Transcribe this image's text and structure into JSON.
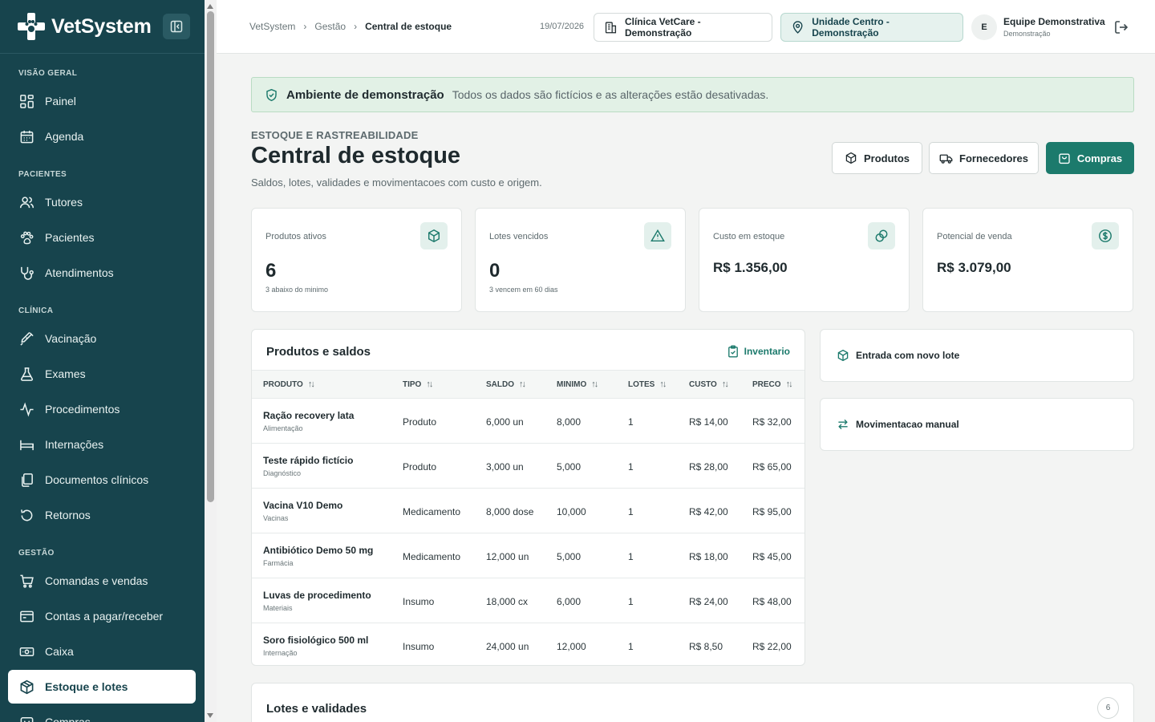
{
  "app": {
    "brand": "VetSystem"
  },
  "sidebar": {
    "sections": {
      "overview": "VISÃO GERAL",
      "patients": "PACIENTES",
      "clinic": "CLÍNICA",
      "management": "GESTÃO"
    },
    "items": [
      {
        "label": "Painel",
        "icon": "grid-icon"
      },
      {
        "label": "Agenda",
        "icon": "calendar-icon"
      },
      {
        "label": "Tutores",
        "icon": "users-icon"
      },
      {
        "label": "Pacientes",
        "icon": "paw-icon"
      },
      {
        "label": "Atendimentos",
        "icon": "stethoscope-icon"
      },
      {
        "label": "Vacinação",
        "icon": "syringe-icon"
      },
      {
        "label": "Exames",
        "icon": "flask-icon"
      },
      {
        "label": "Procedimentos",
        "icon": "activity-icon"
      },
      {
        "label": "Internações",
        "icon": "bed-icon"
      },
      {
        "label": "Documentos clínicos",
        "icon": "documents-icon"
      },
      {
        "label": "Retornos",
        "icon": "rotate-icon"
      },
      {
        "label": "Comandas e vendas",
        "icon": "cart-icon"
      },
      {
        "label": "Contas a pagar/receber",
        "icon": "wallet-icon"
      },
      {
        "label": "Caixa",
        "icon": "cash-icon"
      },
      {
        "label": "Estoque e lotes",
        "icon": "box-icon",
        "active": true
      },
      {
        "label": "Compras",
        "icon": "bag-icon"
      }
    ]
  },
  "topbar": {
    "breadcrumb": [
      "VetSystem",
      "Gestão",
      "Central de estoque"
    ],
    "date": "19/07/2026",
    "clinic": "Clínica VetCare - Demonstração",
    "unit": "Unidade Centro - Demonstração",
    "user": {
      "initial": "E",
      "name": "Equipe Demonstrativa",
      "role": "Demonstração"
    }
  },
  "banner": {
    "title": "Ambiente de demonstração",
    "text": "Todos os dados são fictícios e as alterações estão desativadas."
  },
  "header": {
    "eyebrow": "ESTOQUE E RASTREABILIDADE",
    "title": "Central de estoque",
    "subtitle": "Saldos, lotes, validades e movimentacoes com custo e origem.",
    "buttons": {
      "products": "Produtos",
      "suppliers": "Fornecedores",
      "purchases": "Compras"
    }
  },
  "stats": [
    {
      "label": "Produtos ativos",
      "value": "6",
      "note": "3 abaixo do minimo",
      "icon": "cube-icon"
    },
    {
      "label": "Lotes vencidos",
      "value": "0",
      "note": "3 vencem em 60 dias",
      "icon": "alert-triangle-icon"
    },
    {
      "label": "Custo em estoque",
      "value": "R$ 1.356,00",
      "note": "",
      "icon": "coins-icon"
    },
    {
      "label": "Potencial de venda",
      "value": "R$ 3.079,00",
      "note": "",
      "icon": "dollar-circle-icon"
    }
  ],
  "products": {
    "title": "Produtos e saldos",
    "inventory_link": "Inventario",
    "columns": [
      "PRODUTO",
      "TIPO",
      "SALDO",
      "MINIMO",
      "LOTES",
      "CUSTO",
      "PRECO"
    ],
    "rows": [
      {
        "name": "Ração recovery lata",
        "category": "Alimentação",
        "type": "Produto",
        "balance": "6,000 un",
        "min": "8,000",
        "lots": "1",
        "cost": "R$ 14,00",
        "price": "R$ 32,00"
      },
      {
        "name": "Teste rápido fictício",
        "category": "Diagnóstico",
        "type": "Produto",
        "balance": "3,000 un",
        "min": "5,000",
        "lots": "1",
        "cost": "R$ 28,00",
        "price": "R$ 65,00"
      },
      {
        "name": "Vacina V10 Demo",
        "category": "Vacinas",
        "type": "Medicamento",
        "balance": "8,000 dose",
        "min": "10,000",
        "lots": "1",
        "cost": "R$ 42,00",
        "price": "R$ 95,00"
      },
      {
        "name": "Antibiótico Demo 50 mg",
        "category": "Farmácia",
        "type": "Medicamento",
        "balance": "12,000 un",
        "min": "5,000",
        "lots": "1",
        "cost": "R$ 18,00",
        "price": "R$ 45,00"
      },
      {
        "name": "Luvas de procedimento",
        "category": "Materiais",
        "type": "Insumo",
        "balance": "18,000 cx",
        "min": "6,000",
        "lots": "1",
        "cost": "R$ 24,00",
        "price": "R$ 48,00"
      },
      {
        "name": "Soro fisiológico 500 ml",
        "category": "Internação",
        "type": "Insumo",
        "balance": "24,000 un",
        "min": "12,000",
        "lots": "1",
        "cost": "R$ 8,50",
        "price": "R$ 22,00"
      }
    ]
  },
  "actions": {
    "new_lot": "Entrada com novo lote",
    "manual_move": "Movimentacao manual"
  },
  "lots": {
    "title": "Lotes e validades",
    "count": "6"
  },
  "colors": {
    "sidebar": "#17444d",
    "accent": "#1c7a6c",
    "banner": "#e2f1e6"
  }
}
